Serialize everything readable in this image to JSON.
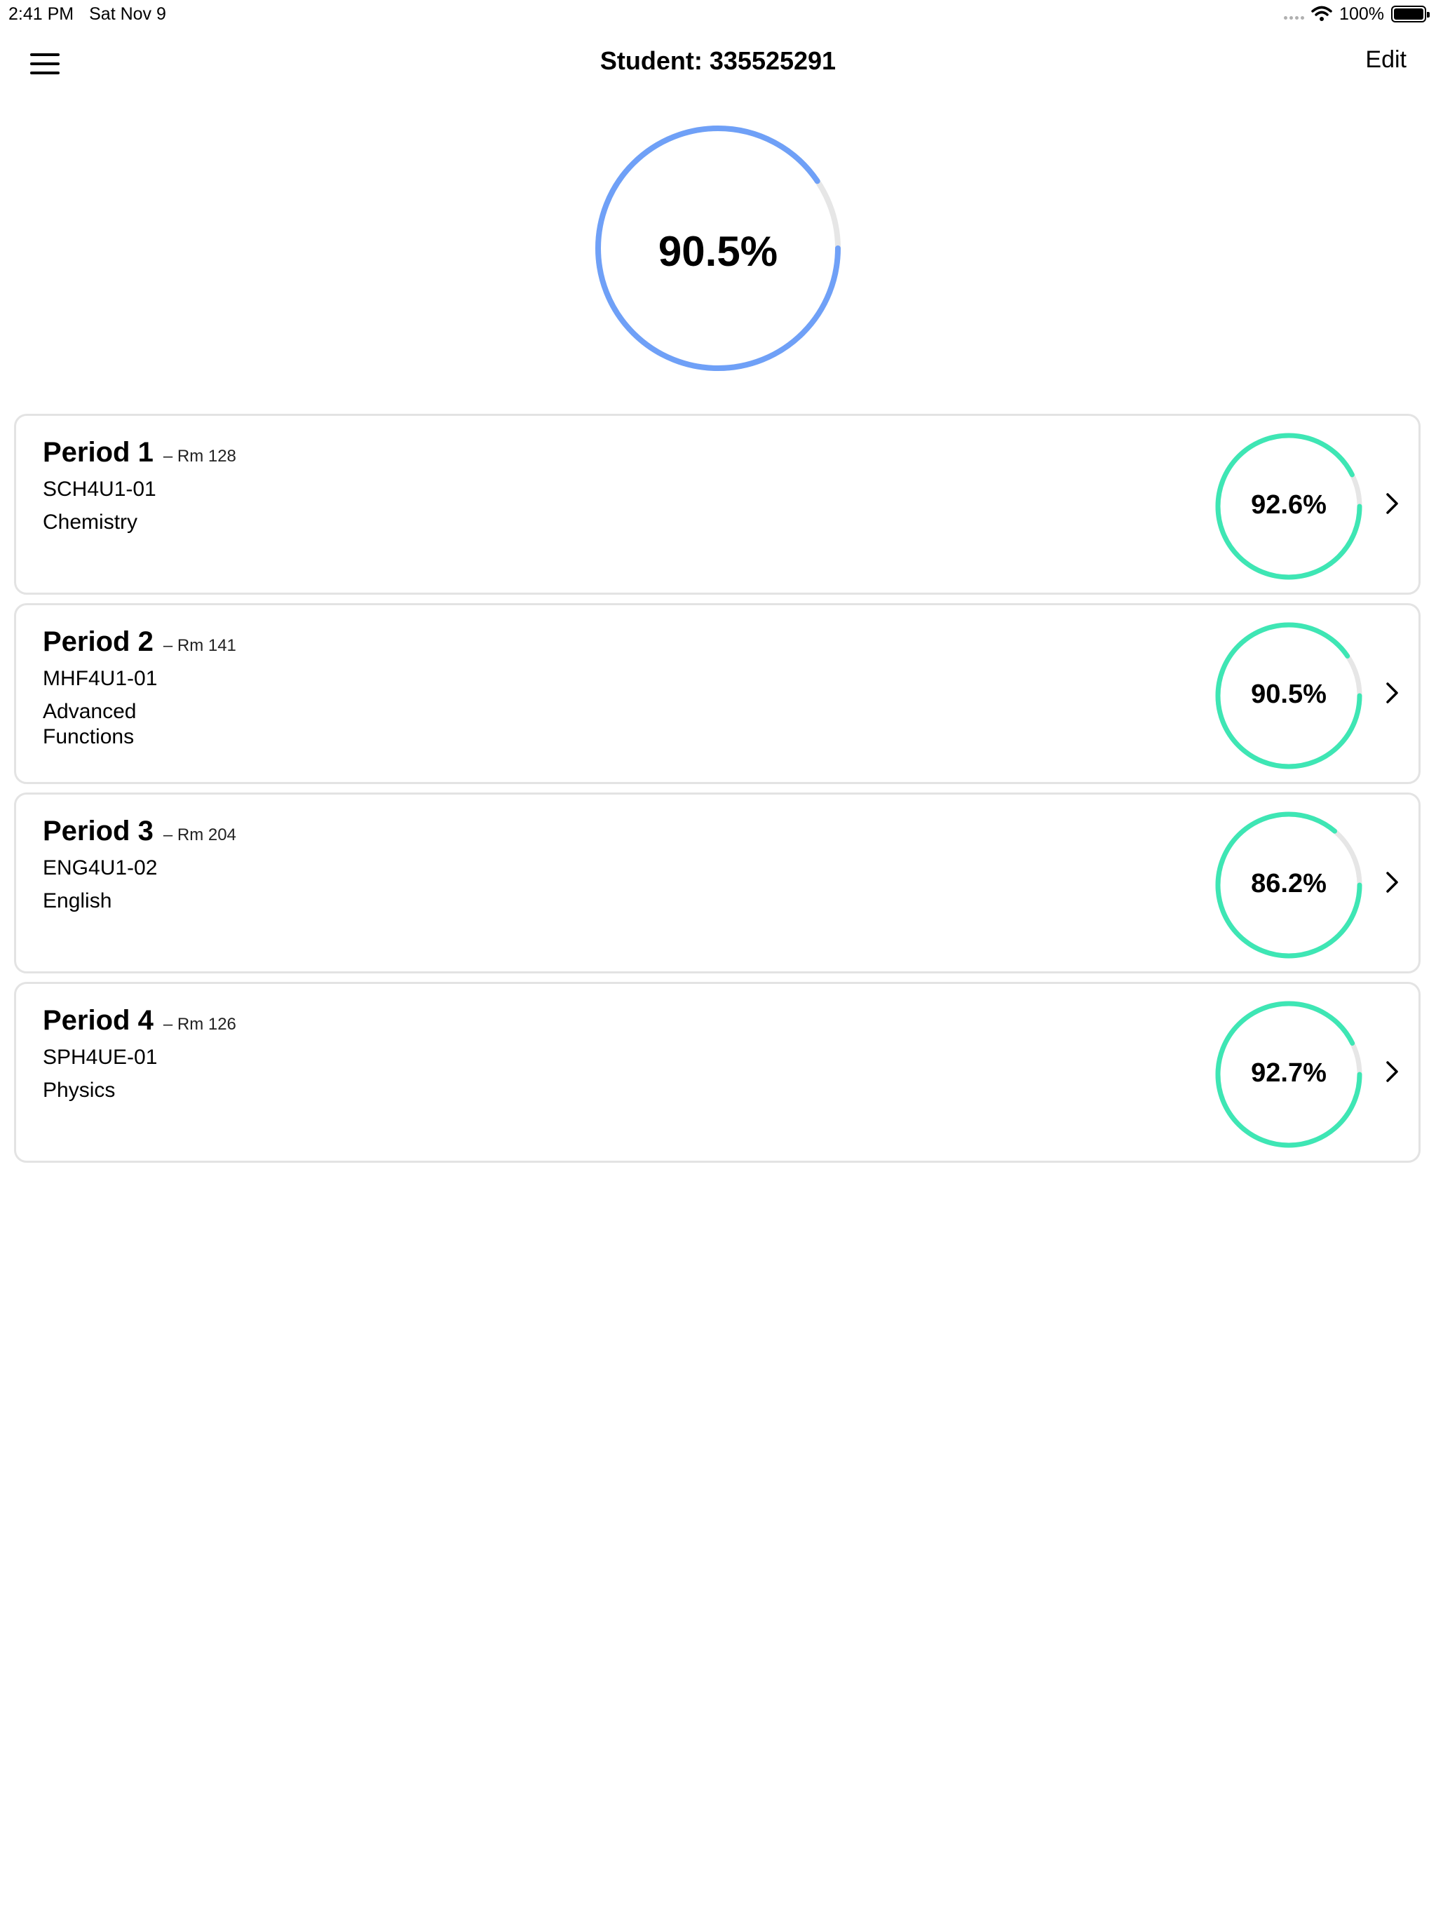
{
  "status_bar": {
    "time": "2:41 PM",
    "date": "Sat Nov 9",
    "battery": "100%",
    "icons": [
      "signal-dots-icon",
      "wifi-icon",
      "battery-icon"
    ]
  },
  "nav": {
    "title": "Student: 335525291",
    "edit_label": "Edit",
    "menu_icon": "hamburger-menu-icon"
  },
  "overall": {
    "average": "90.5%",
    "progress": 0.905,
    "color": "#6fa0f7",
    "track_color": "#e6e6e6"
  },
  "ring_color": "#3ee6b4",
  "periods": [
    {
      "title": "Period 1",
      "room": "– Rm 128",
      "code": "SCH4U1-01",
      "name": "Chemistry",
      "mark": "92.6%",
      "progress": 0.926
    },
    {
      "title": "Period 2",
      "room": "– Rm 141",
      "code": "MHF4U1-01",
      "name": "Advanced Functions",
      "mark": "90.5%",
      "progress": 0.905
    },
    {
      "title": "Period 3",
      "room": "– Rm 204",
      "code": "ENG4U1-02",
      "name": "English",
      "mark": "86.2%",
      "progress": 0.862
    },
    {
      "title": "Period 4",
      "room": "– Rm 126",
      "code": "SPH4UE-01",
      "name": "Physics",
      "mark": "92.7%",
      "progress": 0.927
    }
  ]
}
